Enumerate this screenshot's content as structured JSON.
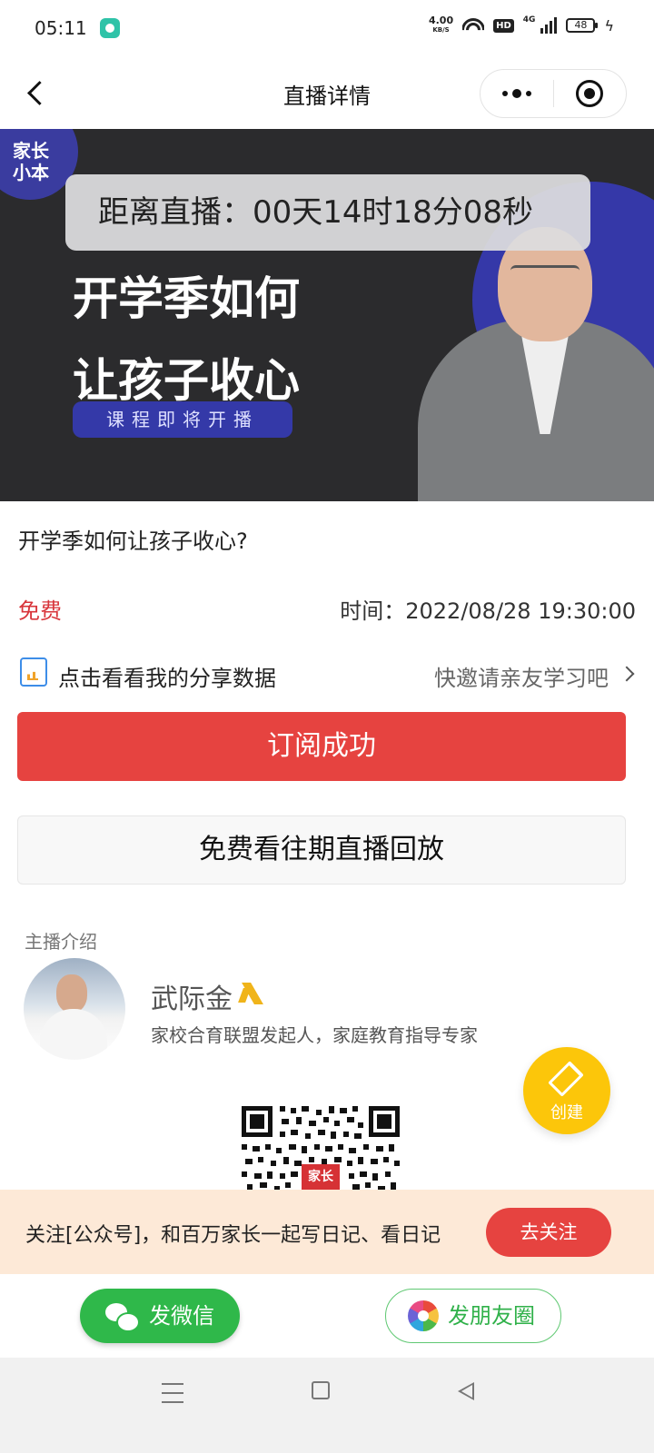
{
  "status_bar": {
    "time": "05:11",
    "net_speed_value": "4.00",
    "net_speed_unit": "KB/S",
    "hd_label": "HD",
    "network_label": "4G",
    "battery": "48"
  },
  "navbar": {
    "title": "直播详情"
  },
  "banner": {
    "brand_line1": "家长",
    "brand_line2": "小本",
    "countdown": "距离直播：00天14时18分08秒",
    "headline_line1": "开学季如何",
    "headline_line2": "让孩子收心",
    "tag": "课程即将开播"
  },
  "course": {
    "title": "开学季如何让孩子收心?",
    "price": "免费",
    "time_label": "时间：",
    "time_value": "2022/08/28 19:30:00"
  },
  "share_row": {
    "label": "点击看看我的分享数据",
    "invite": "快邀请亲友学习吧"
  },
  "buttons": {
    "subscribe": "订阅成功",
    "replay": "免费看往期直播回放"
  },
  "host": {
    "section_title": "主播介绍",
    "name": "武际金",
    "description": "家校合育联盟发起人，家庭教育指导专家"
  },
  "fab": {
    "label": "创建"
  },
  "qr": {
    "logo_text": "家长"
  },
  "follow_bar": {
    "text": "关注[公众号]，和百万家长一起写日记、看日记",
    "button": "去关注"
  },
  "share_bar": {
    "wechat": "发微信",
    "moments": "发朋友圈"
  },
  "colors": {
    "accent_red": "#e64340",
    "price_red": "#d8353b",
    "fab_yellow": "#fcc60a",
    "wechat_green": "#2fb84a",
    "banner_blue": "#3538a8",
    "follow_bg": "#fde9d7"
  }
}
